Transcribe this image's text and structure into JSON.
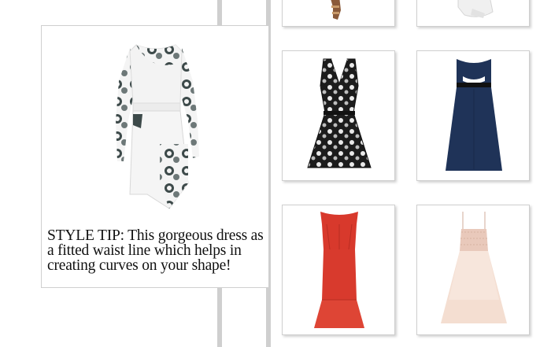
{
  "feature": {
    "image_icon": "floral-white-dress",
    "style_tip": "STYLE TIP: This gorgeous dress as a fitted waist line which helps in creating curves on your shape!"
  },
  "products": [
    {
      "icon": "sandals-partial",
      "color": "#8a5a3a"
    },
    {
      "icon": "white-item-partial",
      "color": "#e8e8e8"
    },
    {
      "icon": "black-white-floral-dress",
      "color": "#1a1a1a"
    },
    {
      "icon": "navy-cutout-gown",
      "color": "#1f3358"
    },
    {
      "icon": "red-off-shoulder-maxi-dress",
      "color": "#d8392c"
    },
    {
      "icon": "blush-tulle-dress",
      "color": "#efd3c6"
    }
  ],
  "colors": {
    "divider": "#cfcfcf",
    "card_border": "#cfcfcf"
  }
}
